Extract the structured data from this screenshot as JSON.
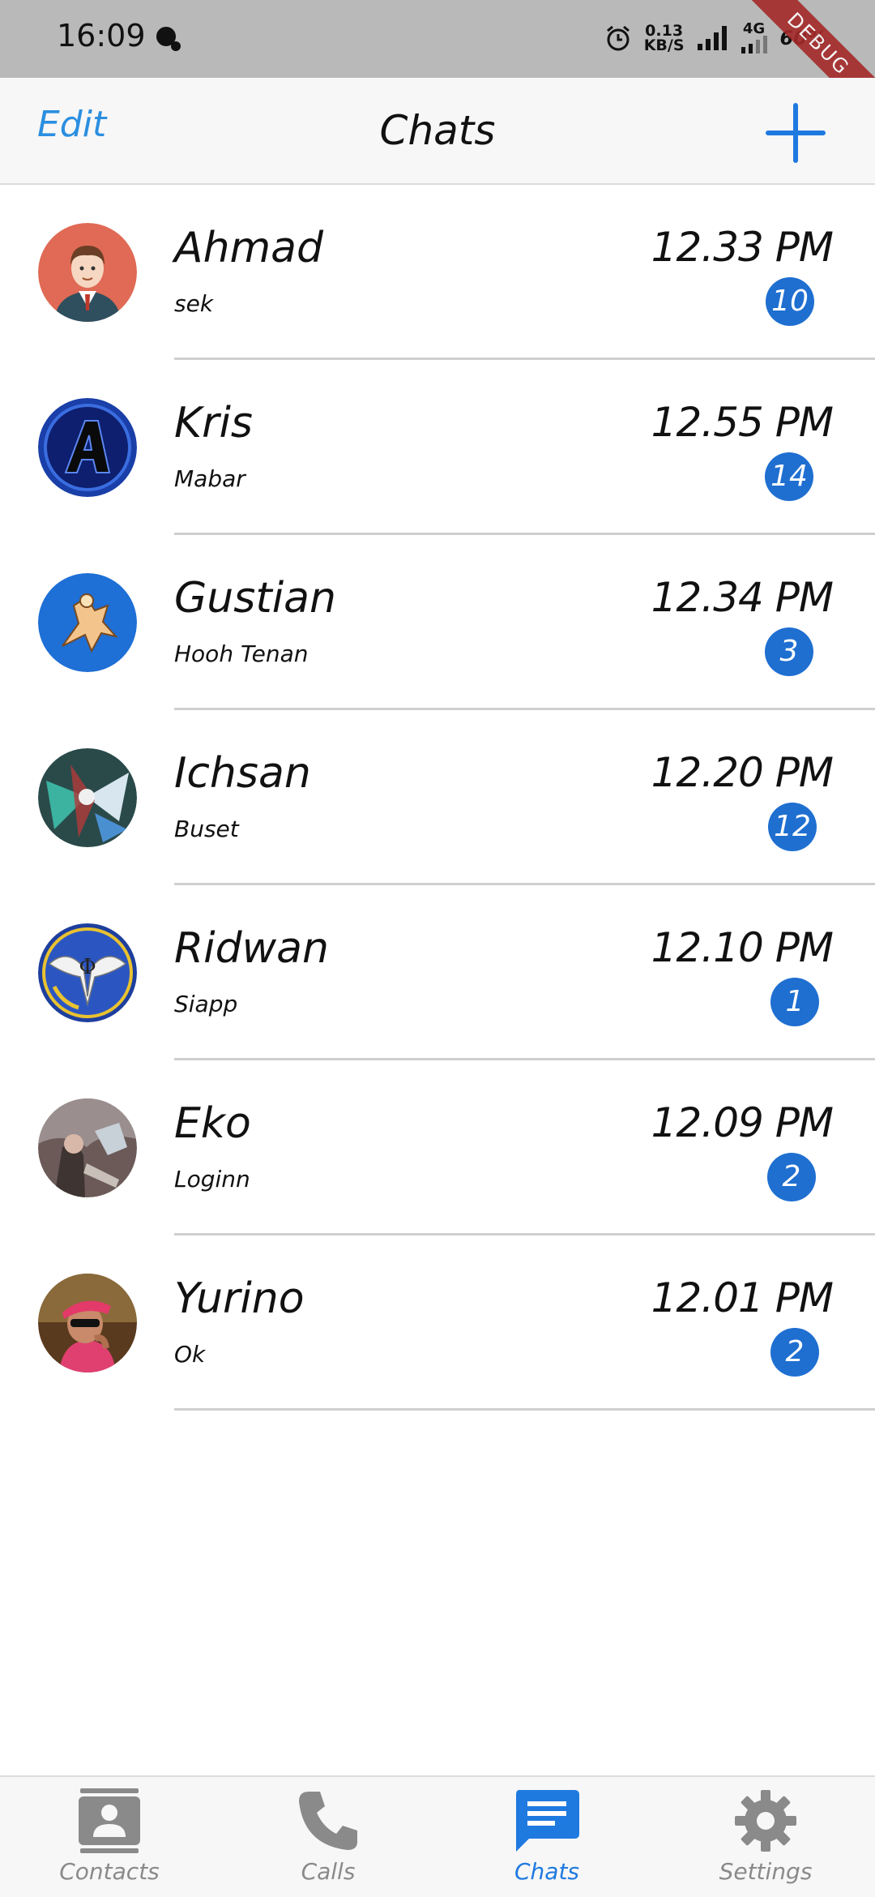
{
  "status_bar": {
    "time": "16:09",
    "speed_value": "0.13",
    "speed_unit": "KB/S",
    "network": "4G",
    "battery": "60%",
    "debug_label": "DEBUG"
  },
  "header": {
    "edit_label": "Edit",
    "title": "Chats",
    "accent_color": "#2b8fe0"
  },
  "chats": [
    {
      "name": "Ahmad",
      "preview": "sek",
      "time": "12.33 PM",
      "unread": "10"
    },
    {
      "name": "Kris",
      "preview": "Mabar",
      "time": "12.55 PM",
      "unread": "14"
    },
    {
      "name": "Gustian",
      "preview": "Hooh Tenan",
      "time": "12.34 PM",
      "unread": "3"
    },
    {
      "name": "Ichsan",
      "preview": "Buset",
      "time": "12.20 PM",
      "unread": "12"
    },
    {
      "name": "Ridwan",
      "preview": "Siapp",
      "time": "12.10 PM",
      "unread": "1"
    },
    {
      "name": "Eko",
      "preview": "Loginn",
      "time": "12.09 PM",
      "unread": "2"
    },
    {
      "name": "Yurino",
      "preview": "Ok",
      "time": "12.01 PM",
      "unread": "2"
    }
  ],
  "tabs": [
    {
      "label": "Contacts",
      "icon": "contacts-icon",
      "active": false
    },
    {
      "label": "Calls",
      "icon": "phone-icon",
      "active": false
    },
    {
      "label": "Chats",
      "icon": "chat-icon",
      "active": true
    },
    {
      "label": "Settings",
      "icon": "gear-icon",
      "active": false
    }
  ],
  "colors": {
    "badge": "#1f6fd1",
    "active_tab": "#1f7ae0",
    "inactive_tab": "#8a8a8a"
  }
}
